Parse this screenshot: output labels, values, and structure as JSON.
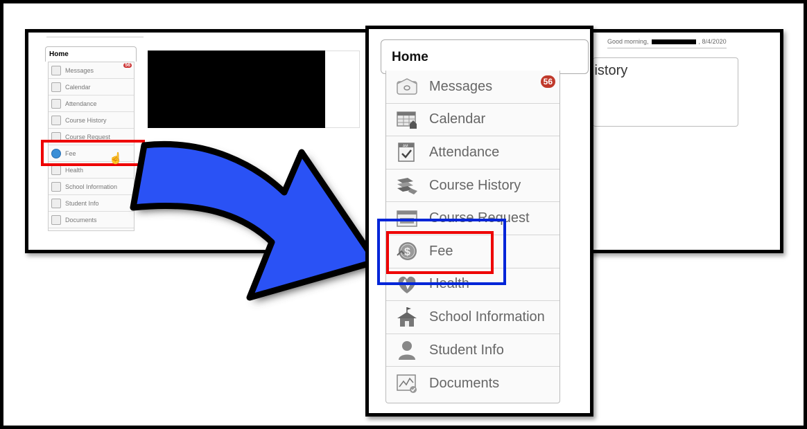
{
  "background": {
    "greeting": "Good morning,",
    "date": ", 8/4/2020",
    "home_tab": "Home",
    "card_title": "History",
    "menu": [
      {
        "label": "Messages",
        "badge": "56"
      },
      {
        "label": "Calendar"
      },
      {
        "label": "Attendance"
      },
      {
        "label": "Course History"
      },
      {
        "label": "Course Request"
      },
      {
        "label": "Fee"
      },
      {
        "label": "Health"
      },
      {
        "label": "School Information"
      },
      {
        "label": "Student Info"
      },
      {
        "label": "Documents"
      }
    ]
  },
  "zoomed": {
    "home_tab": "Home",
    "menu": [
      {
        "label": "Messages",
        "badge": "56",
        "icon": "envelope-icon"
      },
      {
        "label": "Calendar",
        "icon": "calendar-icon"
      },
      {
        "label": "Attendance",
        "icon": "attendance-checkbox-icon"
      },
      {
        "label": "Course History",
        "icon": "books-icon"
      },
      {
        "label": "Course Request",
        "icon": "course-request-icon"
      },
      {
        "label": "Fee",
        "icon": "dollar-coin-icon"
      },
      {
        "label": "Health",
        "icon": "heart-pulse-icon"
      },
      {
        "label": "School Information",
        "icon": "school-house-icon"
      },
      {
        "label": "Student Info",
        "icon": "person-icon"
      },
      {
        "label": "Documents",
        "icon": "document-chart-icon"
      }
    ]
  },
  "colors": {
    "highlight_red": "#e00000",
    "highlight_blue": "#0025d8",
    "arrow_blue": "#2a52f5",
    "badge_red": "#c0392b"
  }
}
